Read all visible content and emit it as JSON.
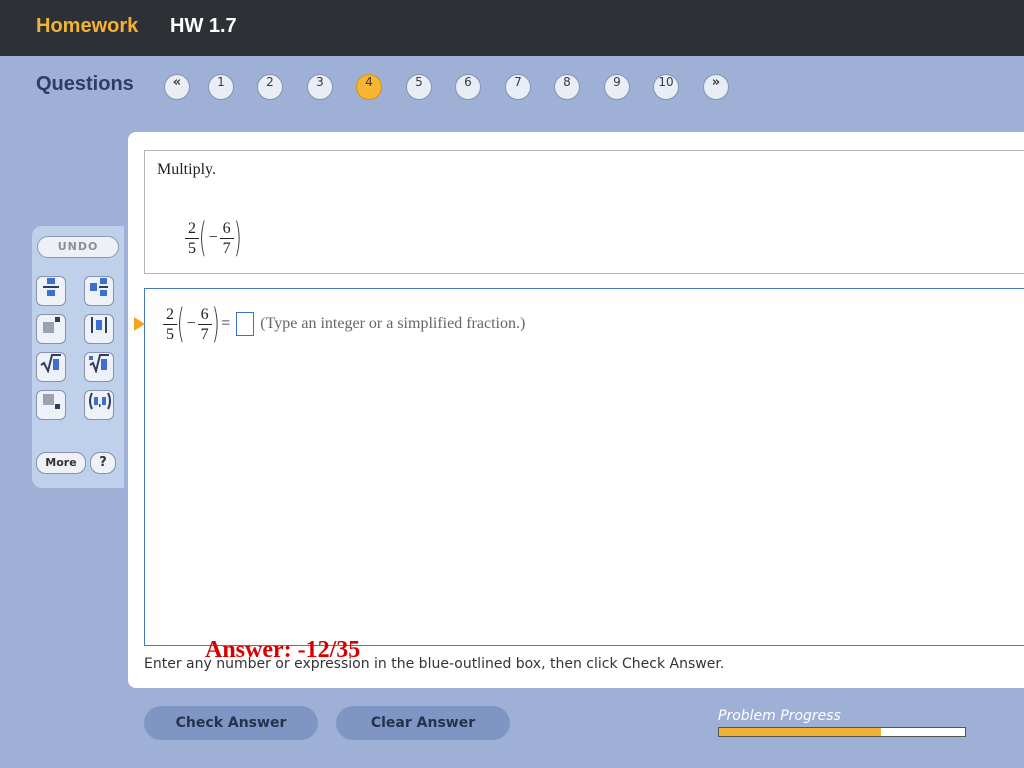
{
  "header": {
    "section": "Homework",
    "title": "HW 1.7"
  },
  "nav": {
    "label": "Questions",
    "prev_symbol": "«",
    "next_symbol": "»",
    "questions": [
      "1",
      "2",
      "3",
      "4",
      "5",
      "6",
      "7",
      "8",
      "9",
      "10"
    ],
    "active": "4"
  },
  "tools": {
    "undo_label": "UNDO",
    "more_label": "More",
    "help_label": "?",
    "items": [
      "fraction-icon",
      "mixed-number-icon",
      "exponent-icon",
      "absolute-value-icon",
      "square-root-icon",
      "nth-root-icon",
      "subscript-icon",
      "ordered-pair-icon"
    ]
  },
  "problem": {
    "instruction": "Multiply.",
    "expression": {
      "a_num": "2",
      "a_den": "5",
      "sign": "−",
      "b_num": "6",
      "b_den": "7"
    }
  },
  "answer": {
    "equals": "=",
    "hint": "(Type an integer or a simplified fraction.)",
    "value": "",
    "annotation": "Answer: -12/35"
  },
  "footer": {
    "instructions": "Enter any number or expression in the blue-outlined box, then click Check Answer.",
    "check_label": "Check Answer",
    "clear_label": "Clear Answer",
    "progress_label": "Problem Progress",
    "progress_fraction": 0.66
  },
  "colors": {
    "accent": "#f7b531",
    "header_bg": "#2d3136",
    "page_bg": "#9fb0d6",
    "answer_outline": "#4a74c4",
    "annotation": "#d60000"
  }
}
